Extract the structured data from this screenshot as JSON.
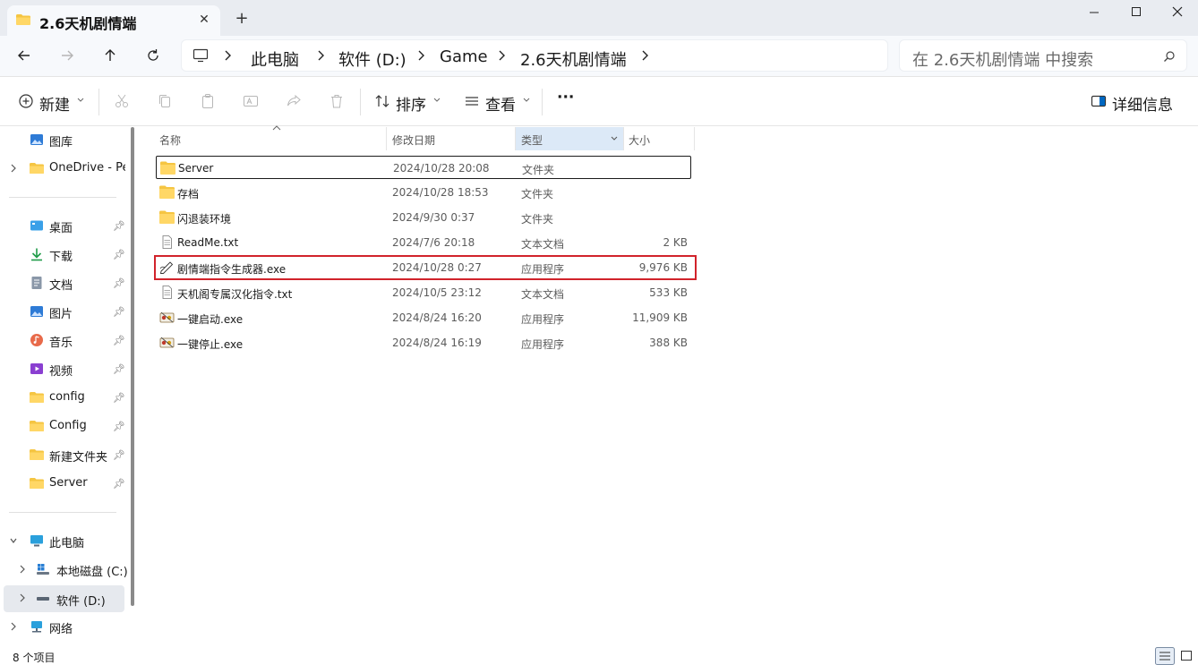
{
  "window": {
    "tab_title": "2.6天机剧情端",
    "close_tab_glyph": "✕",
    "new_tab_glyph": "+"
  },
  "address": {
    "crumbs": [
      "此电脑",
      "软件 (D:)",
      "Game",
      "2.6天机剧情端"
    ]
  },
  "search": {
    "placeholder": "在 2.6天机剧情端 中搜索"
  },
  "command_bar": {
    "new_label": "新建",
    "sort_label": "排序",
    "view_label": "查看",
    "more_label": "···",
    "details_label": "详细信息"
  },
  "sidebar": {
    "items": [
      {
        "label": "图库",
        "icon": "gallery-icon"
      },
      {
        "label": "OneDrive - Per",
        "icon": "folder-icon"
      },
      {
        "label": "桌面",
        "icon": "desktop-icon"
      },
      {
        "label": "下载",
        "icon": "download-icon"
      },
      {
        "label": "文档",
        "icon": "document-icon"
      },
      {
        "label": "图片",
        "icon": "pictures-icon"
      },
      {
        "label": "音乐",
        "icon": "music-icon"
      },
      {
        "label": "视频",
        "icon": "video-icon"
      },
      {
        "label": "config",
        "icon": "folder-icon"
      },
      {
        "label": "Config",
        "icon": "folder-icon"
      },
      {
        "label": "新建文件夹 (",
        "icon": "folder-icon"
      },
      {
        "label": "Server",
        "icon": "folder-icon"
      },
      {
        "label": "此电脑",
        "icon": "computer-icon"
      },
      {
        "label": "本地磁盘 (C:)",
        "icon": "windows-drive-icon"
      },
      {
        "label": "软件 (D:)",
        "icon": "drive-icon"
      },
      {
        "label": "网络",
        "icon": "network-icon"
      }
    ]
  },
  "columns": {
    "name": "名称",
    "date": "修改日期",
    "type": "类型",
    "size": "大小"
  },
  "files": [
    {
      "name": "Server",
      "date": "2024/10/28 20:08",
      "type": "文件夹",
      "size": "",
      "icon": "folder-icon"
    },
    {
      "name": "存档",
      "date": "2024/10/28 18:53",
      "type": "文件夹",
      "size": "",
      "icon": "folder-icon"
    },
    {
      "name": "闪退装环境",
      "date": "2024/9/30 0:37",
      "type": "文件夹",
      "size": "",
      "icon": "folder-icon"
    },
    {
      "name": "ReadMe.txt",
      "date": "2024/7/6 20:18",
      "type": "文本文档",
      "size": "2 KB",
      "icon": "text-file-icon"
    },
    {
      "name": "剧情端指令生成器.exe",
      "date": "2024/10/28 0:27",
      "type": "应用程序",
      "size": "9,976 KB",
      "icon": "app-pen-icon"
    },
    {
      "name": "天机阁专属汉化指令.txt",
      "date": "2024/10/5 23:12",
      "type": "文本文档",
      "size": "533 KB",
      "icon": "text-file-icon"
    },
    {
      "name": "一键启动.exe",
      "date": "2024/8/24 16:20",
      "type": "应用程序",
      "size": "11,909 KB",
      "icon": "app-icon"
    },
    {
      "name": "一键停止.exe",
      "date": "2024/8/24 16:19",
      "type": "应用程序",
      "size": "388 KB",
      "icon": "app-icon"
    }
  ],
  "status": {
    "item_count": "8 个项目"
  },
  "colors": {
    "highlight": "#d1232b",
    "folder": "#f5c542",
    "accent": "#0067c0"
  }
}
